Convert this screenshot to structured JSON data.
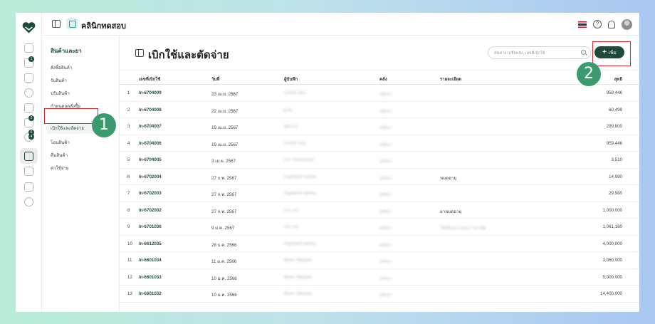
{
  "app": {
    "clinic_name": "คลินิกทดสอบ"
  },
  "topbar": {
    "icons": [
      "sidebar-toggle-icon",
      "clinic-home-icon",
      "thai-flag-icon",
      "help-icon",
      "bell-icon",
      "avatar"
    ]
  },
  "rail": {
    "badges": [
      "1",
      "2",
      "6",
      "4"
    ]
  },
  "category_sidebar": {
    "title": "สินค้าและยา",
    "items": [
      {
        "label": "สั่งซื้อสินค้า"
      },
      {
        "label": "รับสินค้า"
      },
      {
        "label": "ปรับสินค้า"
      },
      {
        "label": "กำหนดจุดสั่งซื้อ"
      },
      {
        "label": "เบิกใช้และตัดจ่าย"
      },
      {
        "label": "โอนสินค้า"
      },
      {
        "label": "คืนสินค้า"
      },
      {
        "label": "ค่าใช้จ่าย"
      }
    ],
    "active_index": 4
  },
  "main": {
    "title": "เบิกใช้และตัดจ่าย",
    "search": {
      "placeholder": "ค้นหาจากชื่อคลัง, เลขที่เบิกใช้",
      "value": ""
    },
    "add_label": "เพิ่ม"
  },
  "table": {
    "headers": {
      "code": "เลขที่เบิกใช้",
      "date": "วันที่",
      "recorder": "ผู้บันทึก",
      "warehouse": "คลัง",
      "detail": "รายละเอียด",
      "net": "สุทธิ"
    },
    "rows": [
      {
        "num": "1",
        "code": "In-6704009",
        "date": "23 เม.ย. 2567",
        "recorder": "CHAN Test",
        "warehouse": "คลังยา",
        "detail": "",
        "net": "959,446"
      },
      {
        "num": "2",
        "code": "In-6704008",
        "date": "22 เม.ย. 2567",
        "recorder": "jj.aa",
        "warehouse": "คลังยา",
        "detail": "",
        "net": "60,499"
      },
      {
        "num": "3",
        "code": "In-6704007",
        "date": "19 เม.ย. 2567",
        "recorder": "gfd.ccc",
        "warehouse": "คลังยา",
        "detail": "",
        "net": "299,800"
      },
      {
        "num": "4",
        "code": "In-6704006",
        "date": "19 เม.ย. 2567",
        "recorder": "CHAN Test",
        "warehouse": "คลังยา",
        "detail": "",
        "net": "959,446"
      },
      {
        "num": "5",
        "code": "In-6704005",
        "date": "3 เม.ย. 2567",
        "recorder": "xxx Tiaranasait",
        "warehouse": "คลังยา",
        "detail": "",
        "net": "3,510"
      },
      {
        "num": "6",
        "code": "In-6702004",
        "date": "27 ก.พ. 2567",
        "recorder": "Suphanit Adsina",
        "warehouse": "คลังยา",
        "detail": "หมดอายุ",
        "net": "14,990"
      },
      {
        "num": "7",
        "code": "In-6702003",
        "date": "27 ก.พ. 2567",
        "recorder": "Suphanit Adsina",
        "warehouse": "คลังยา",
        "detail": "",
        "net": "29,980"
      },
      {
        "num": "8",
        "code": "In-6702002",
        "date": "27 ก.พ. 2567",
        "recorder": "ccc ccc",
        "warehouse": "คลังยา",
        "detail": "ยาหมดอายุ",
        "net": "1,000,000"
      },
      {
        "num": "9",
        "code": "In-6701036",
        "date": "9 ม.ค. 2567",
        "recorder": "ccc ccc",
        "warehouse": "คลังยา",
        "detail": "ใช้เพื่อประกอบการผ่าตัด",
        "net": "1,061,160"
      },
      {
        "num": "10",
        "code": "In-6612035",
        "date": "28 ธ.ค. 2566",
        "recorder": "Suphanit Adsina",
        "warehouse": "คลังยา",
        "detail": "",
        "net": "4,000,000"
      },
      {
        "num": "11",
        "code": "In-6601034",
        "date": "11 ม.ค. 2566",
        "recorder": "Bbon Jabaraa",
        "warehouse": "คลังยา",
        "detail": "",
        "net": "3,060,000"
      },
      {
        "num": "12",
        "code": "In-6601033",
        "date": "10 ม.ค. 2566",
        "recorder": "Bbon Jabaraa",
        "warehouse": "คลังยา",
        "detail": "",
        "net": "5,000,000"
      },
      {
        "num": "13",
        "code": "In-6601032",
        "date": "10 ม.ค. 2566",
        "recorder": "Bbon Jabaraa",
        "warehouse": "คลังยา",
        "detail": "",
        "net": "14,400,000"
      }
    ]
  },
  "annotations": {
    "step1": "1",
    "step2": "2",
    "highlight_color": "#e0262b",
    "badge_color": "#3c9a6f"
  },
  "colors": {
    "brand": "#1f4a3a",
    "accent": "#3c9a6f"
  }
}
